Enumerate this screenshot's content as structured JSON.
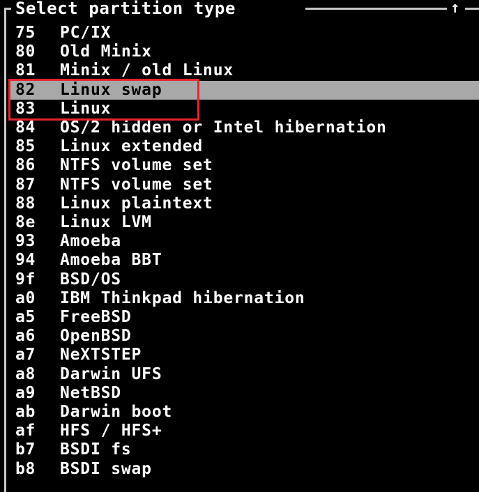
{
  "dialog": {
    "title": "Select partition type",
    "scroll_indicator": "↑"
  },
  "partition_types": [
    {
      "code": "75",
      "name": "PC/IX",
      "selected": false
    },
    {
      "code": "80",
      "name": "Old Minix",
      "selected": false
    },
    {
      "code": "81",
      "name": "Minix / old Linux",
      "selected": false
    },
    {
      "code": "82",
      "name": "Linux swap",
      "selected": true
    },
    {
      "code": "83",
      "name": "Linux",
      "selected": false
    },
    {
      "code": "84",
      "name": "OS/2 hidden or Intel hibernation",
      "selected": false
    },
    {
      "code": "85",
      "name": "Linux extended",
      "selected": false
    },
    {
      "code": "86",
      "name": "NTFS volume set",
      "selected": false
    },
    {
      "code": "87",
      "name": "NTFS volume set",
      "selected": false
    },
    {
      "code": "88",
      "name": "Linux plaintext",
      "selected": false
    },
    {
      "code": "8e",
      "name": "Linux LVM",
      "selected": false
    },
    {
      "code": "93",
      "name": "Amoeba",
      "selected": false
    },
    {
      "code": "94",
      "name": "Amoeba BBT",
      "selected": false
    },
    {
      "code": "9f",
      "name": "BSD/OS",
      "selected": false
    },
    {
      "code": "a0",
      "name": "IBM Thinkpad hibernation",
      "selected": false
    },
    {
      "code": "a5",
      "name": "FreeBSD",
      "selected": false
    },
    {
      "code": "a6",
      "name": "OpenBSD",
      "selected": false
    },
    {
      "code": "a7",
      "name": "NeXTSTEP",
      "selected": false
    },
    {
      "code": "a8",
      "name": "Darwin UFS",
      "selected": false
    },
    {
      "code": "a9",
      "name": "NetBSD",
      "selected": false
    },
    {
      "code": "ab",
      "name": "Darwin boot",
      "selected": false
    },
    {
      "code": "af",
      "name": "HFS / HFS+",
      "selected": false
    },
    {
      "code": "b7",
      "name": "BSDI fs",
      "selected": false
    },
    {
      "code": "b8",
      "name": "BSDI swap",
      "selected": false
    }
  ],
  "colors": {
    "background": "#000000",
    "text": "#ffffff",
    "selection": "#a8a8a8",
    "annotation": "#e8242a"
  }
}
